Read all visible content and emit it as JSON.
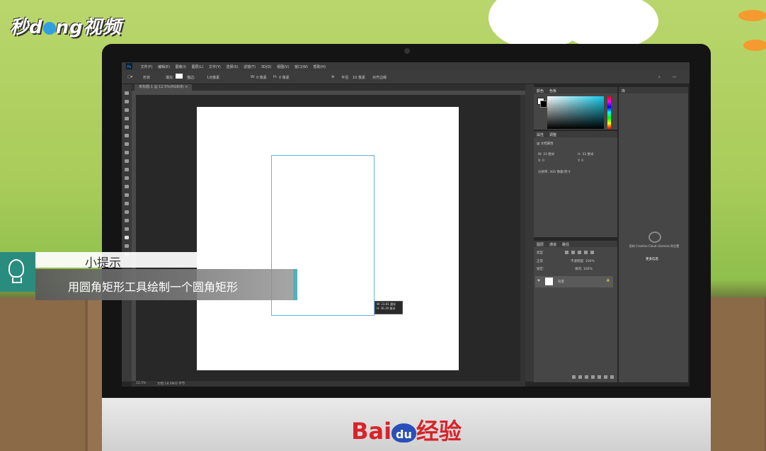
{
  "overlay": {
    "logo_a": "秒d",
    "logo_b": "ng视频",
    "tip_title": "小提示",
    "tip_text": "用圆角矩形工具绘制一个圆角矩形",
    "brand_bai": "Bai",
    "brand_du": "du",
    "brand_cn": "经验"
  },
  "ps": {
    "menu": [
      "文件(F)",
      "编辑(E)",
      "图像(I)",
      "图层(L)",
      "文字(Y)",
      "选择(S)",
      "滤镜(T)",
      "3D(D)",
      "视图(V)",
      "窗口(W)",
      "帮助(H)"
    ],
    "options": {
      "mode": "形状",
      "fill_label": "填充:",
      "stroke_label": "描边:",
      "stroke_width": "1点像素",
      "w_label": "W:",
      "w_value": "0 像素",
      "h_label": "H:",
      "h_value": "0 像素",
      "radius_label": "半径:",
      "radius_value": "10 像素",
      "align_edges": "对齐边缘"
    },
    "doc_tab": "未标题-1 @ 12.5%(RGB/8)",
    "tooltip_w": "W: 23.81 厘米",
    "tooltip_h": "H: 36.39 厘米",
    "status_zoom": "12.5%",
    "status_doc": "文档:18.0M/0 字节"
  },
  "panels": {
    "color_tab": "颜色",
    "swatches_tab": "色板",
    "properties_tab": "属性",
    "adjustments_tab": "调整",
    "doc_props": "文档属性",
    "w": "W: 33 厘米",
    "h": "H: 33 厘米",
    "x": "X: 0",
    "y": "Y: 0",
    "resolution": "分辨率: 300 像素/英寸",
    "layers_tab": "图层",
    "channels_tab": "通道",
    "paths_tab": "路径",
    "kind": "类型",
    "normal": "正常",
    "opacity": "不透明度: 100%",
    "lock": "锁定:",
    "fill": "填充: 100%",
    "layer_name": "背景",
    "libraries_tab": "库",
    "libraries_text": "您的 Creative Cloud Libraries 的位置",
    "libraries_link": "更多信息"
  }
}
